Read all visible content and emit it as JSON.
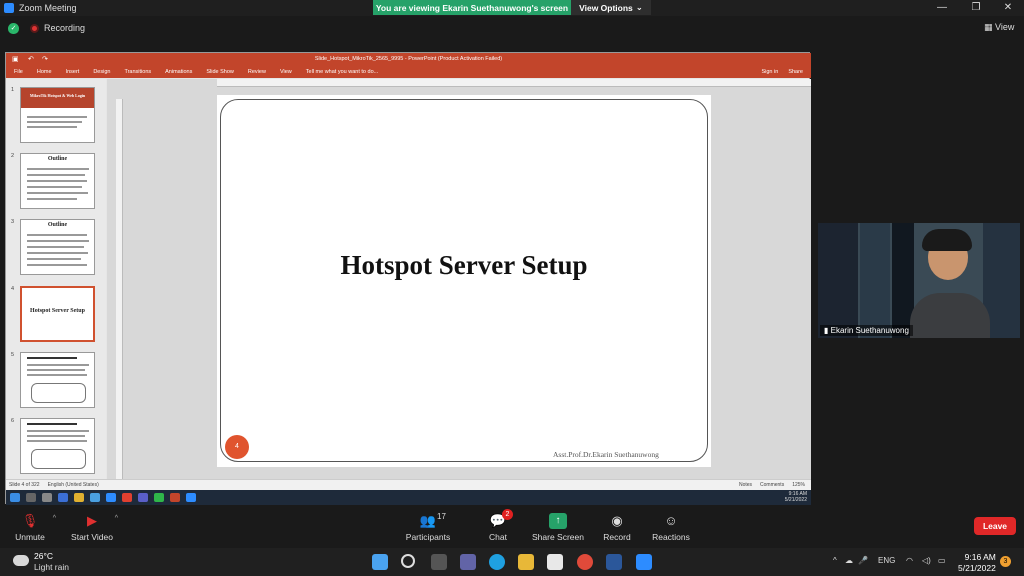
{
  "window": {
    "title": "Zoom Meeting",
    "minimize": "—",
    "restore": "❐",
    "close": "✕"
  },
  "banner": {
    "viewing": "You are viewing Ekarin Suethanuwong's screen",
    "view_options": "View Options"
  },
  "meeting": {
    "recording_label": "Recording",
    "view_label": "View"
  },
  "ppt": {
    "doc_title": "Slide_Hotspot_MikroTik_2565_9995 - PowerPoint (Product Activation Failed)",
    "ribbon_tabs": [
      "File",
      "Home",
      "Insert",
      "Design",
      "Transitions",
      "Animations",
      "Slide Show",
      "Review",
      "View"
    ],
    "tell_me": "Tell me what you want to do...",
    "sign_in": "Sign in",
    "share": "Share",
    "thumbnails": [
      {
        "num": "1",
        "title": "MikroTik Hotspot & Web Login"
      },
      {
        "num": "2",
        "title": "Outline"
      },
      {
        "num": "3",
        "title": "Outline"
      },
      {
        "num": "4",
        "title": "Hotspot Server Setup"
      },
      {
        "num": "5",
        "title": ""
      },
      {
        "num": "6",
        "title": ""
      }
    ],
    "slide": {
      "title": "Hotspot Server Setup",
      "number": "4",
      "author": "Asst.Prof.Dr.Ekarin Suethanuwong"
    },
    "status": {
      "slide_of": "Slide 4 of 322",
      "language": "English (United States)",
      "notes": "Notes",
      "comments": "Comments",
      "zoom": "125%"
    },
    "inner_clock": {
      "time": "9:16 AM",
      "date": "5/21/2022"
    }
  },
  "video": {
    "participant_name": "Ekarin Suethanuwong"
  },
  "toolbar": {
    "unmute": "Unmute",
    "start_video": "Start Video",
    "participants": "Participants",
    "participants_count": "17",
    "chat": "Chat",
    "chat_badge": "2",
    "share_screen": "Share Screen",
    "record": "Record",
    "reactions": "Reactions",
    "leave": "Leave"
  },
  "taskbar": {
    "temperature": "26°C",
    "weather": "Light rain",
    "lang": "ENG",
    "time": "9:16 AM",
    "date": "5/21/2022",
    "notifications": "3"
  },
  "colors": {
    "ppt_accent": "#c2452b",
    "share_green": "#26a269",
    "leave_red": "#e02828",
    "slide_number": "#e0542e"
  }
}
